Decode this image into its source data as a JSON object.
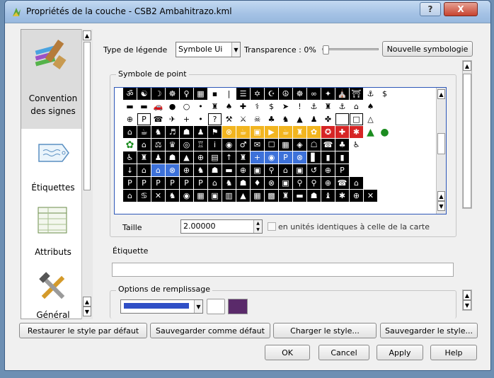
{
  "window": {
    "title": "Propriétés de la couche - CSB2 Ambahitrazo.kml",
    "help_glyph": "?",
    "close_glyph": "X"
  },
  "sidebar": {
    "items": [
      {
        "label": "Convention des signes",
        "icon": "paintbrush-icon"
      },
      {
        "label": "Étiquettes",
        "icon": "label-tag-icon"
      },
      {
        "label": "Attributs",
        "icon": "table-icon"
      },
      {
        "label": "Général",
        "icon": "tools-icon"
      }
    ]
  },
  "toolbar": {
    "legend_type_label": "Type de légende",
    "legend_type_value": "Symbole Ui",
    "transparency_label": "Transparence : 0%",
    "transparency_value": 0,
    "new_symbology_label": "Nouvelle symbologie"
  },
  "point_symbol": {
    "group_title": "Symbole de point",
    "size_label": "Taille",
    "size_value": "2.00000",
    "map_units_label": "en unités identiques à celle de la carte"
  },
  "etiquette": {
    "label": "Étiquette",
    "value": ""
  },
  "fill": {
    "group_title": "Options de remplissage",
    "colors": [
      "#2f4fc6",
      "#ffffff",
      "#5a2a6a"
    ]
  },
  "buttons": {
    "restore_default": "Restaurer le style par défaut",
    "save_default": "Sauvegarder comme défaut",
    "load_style": "Charger le style...",
    "save_style": "Sauvegarder le style...",
    "ok": "OK",
    "cancel": "Cancel",
    "apply": "Apply",
    "help": "Help"
  },
  "symbols": [
    [
      "d:ॐ",
      "d:☯",
      "d:☽",
      "d:☸",
      "d:♀",
      "d:▦",
      "l:▪",
      "l:|",
      "d:☰",
      "d:✡",
      "d:☪",
      "d:☮",
      "d:☸",
      "d:∞",
      "d:✦",
      "d:⛪",
      "d:⛩",
      "l:⚓",
      "l:$"
    ],
    [
      "l:▬",
      "l:▬",
      "l:🚗",
      "l:●",
      "l:○",
      "l:•",
      "l:♜",
      "l:♠",
      "l:✚",
      "l:⚕",
      "l:$",
      "l:➤",
      "l:!",
      "l:⚓",
      "l:♜",
      "l:⚓",
      "l:⌂",
      "l:♠"
    ],
    [
      "l:⊕",
      "o:P",
      "l:☎",
      "l:✈",
      "l:+",
      "l:•",
      "o:?",
      "l:⚒",
      "l:⚔",
      "l:☠",
      "l:♣",
      "l:♞",
      "l:▲",
      "l:♟",
      "l:✤",
      "o:",
      "o:□",
      "l:△"
    ],
    [
      "d:⌂",
      "d:☕",
      "d:♞",
      "d:♬",
      "d:☗",
      "d:♟",
      "d:⚑",
      "y:⊗",
      "y:☕",
      "y:▣",
      "y:▶",
      "y:☕",
      "y:♜",
      "y:✿",
      "r:✪",
      "r:✚",
      "r:✱",
      "g:▲",
      "g:●"
    ],
    [
      "g:✿",
      "d:⌂",
      "d:⚖",
      "d:♛",
      "d:◎",
      "d:♖",
      "d:i",
      "d:◉",
      "d:♂",
      "d:✉",
      "d:☐",
      "d:▦",
      "d:◈",
      "d:☖",
      "d:☎",
      "d:♣",
      "l:♿"
    ],
    [
      "d:♿",
      "d:♜",
      "d:♟",
      "d:☗",
      "d:▲",
      "d:⊕",
      "d:▤",
      "d:↑",
      "d:♜",
      "b:+",
      "b:◉",
      "b:P",
      "b:⊗",
      "d:▋",
      "d:▮",
      "d:▮"
    ],
    [
      "d:↓",
      "d:⌂",
      "b:⌂",
      "b:⊗",
      "d:⊕",
      "d:♞",
      "d:☗",
      "d:▬",
      "d:⊕",
      "d:▣",
      "d:⚲",
      "d:⌂",
      "d:▣",
      "d:↺",
      "d:⊕",
      "d:P"
    ],
    [
      "d:P",
      "d:P",
      "d:P",
      "d:P",
      "d:P",
      "d:P",
      "d:⌂",
      "d:♞",
      "d:☗",
      "d:♦",
      "d:⊗",
      "d:▣",
      "d:⚲",
      "d:⚲",
      "d:⊕",
      "d:☎",
      "d:⌂"
    ],
    [
      "d:⌂",
      "d:♋",
      "d:✕",
      "d:♞",
      "d:◉",
      "d:▦",
      "d:▣",
      "d:▥",
      "d:▲",
      "d:▦",
      "d:▩",
      "d:♜",
      "d:▬",
      "d:☗",
      "d:♝",
      "d:✱",
      "d:⊕",
      "d:✕"
    ]
  ]
}
